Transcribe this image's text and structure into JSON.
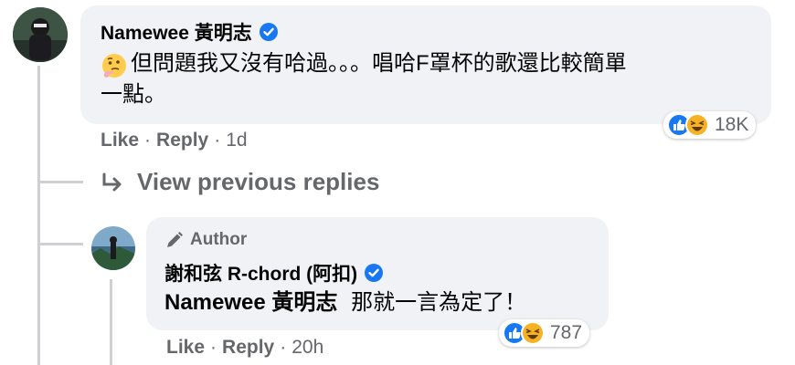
{
  "comment1": {
    "author": "Namewee 黃明志",
    "text_line1": "但問題我又沒有哈過。。。唱哈F罩杯的歌還比較簡單",
    "text_line2": "一點。",
    "reaction_count": "18K",
    "actions": {
      "like": "Like",
      "reply": "Reply",
      "time": "1d"
    }
  },
  "view_previous": {
    "label": "View previous replies"
  },
  "reply1": {
    "author_badge": "Author",
    "author": "謝和弦 R-chord (阿扣)",
    "mention": "Namewee 黃明志",
    "text": "那就一言為定了！",
    "reaction_count": "787",
    "actions": {
      "like": "Like",
      "reply": "Reply",
      "time": "20h"
    }
  },
  "colors": {
    "verified": "#1877f2",
    "secondary_text": "#65676b",
    "bubble": "#f0f2f5"
  },
  "icons": [
    "verified-badge-icon",
    "thinking-emoji-icon",
    "like-reaction-icon",
    "haha-reaction-icon",
    "reply-arrow-icon",
    "pencil-icon"
  ]
}
